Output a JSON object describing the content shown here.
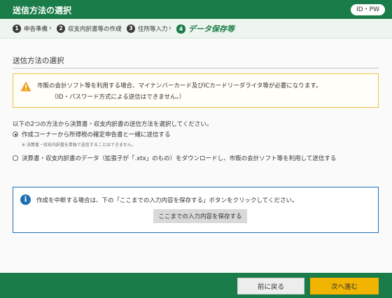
{
  "header": {
    "title": "送信方法の選択",
    "badge": "ID・PW"
  },
  "steps": [
    {
      "num": "1",
      "label": "申告準備",
      "active": false
    },
    {
      "num": "2",
      "label": "収支内訳書等の作成",
      "active": false
    },
    {
      "num": "3",
      "label": "住所等入力",
      "active": false
    },
    {
      "num": "4",
      "label": "データ保存等",
      "active": true
    }
  ],
  "step_separator": "›",
  "section": {
    "title": "送信方法の選択"
  },
  "warning": {
    "line1": "市販の会計ソフト等を利用する場合、マイナンバーカード及びICカードリーダライタ等が必要になります。",
    "line2": "（ID・パスワード方式による送信はできません。）"
  },
  "instruction": "以下の2つの方法から決算書・収支内訳書の送信方法を選択してください。",
  "options": [
    {
      "label": "作成コーナーから所得税の確定申告書と一緒に送信する",
      "checked": true,
      "note": "※ 決算書・収支内訳書を単独で送信することはできません。"
    },
    {
      "label": "決算書・収支内訳書のデータ（拡張子が「.xtx」のもの）をダウンロードし、市販の会計ソフト等を利用して送信する",
      "checked": false,
      "note": ""
    }
  ],
  "info": {
    "icon_char": "i",
    "text": "作成を中断する場合は、下の「ここまでの入力内容を保存する」ボタンをクリックしてください。",
    "save_button": "ここまでの入力内容を保存する"
  },
  "footer": {
    "back_label": "前に戻る",
    "next_label": "次へ進む"
  },
  "colors": {
    "brand_green": "#1a7c48",
    "warning_border": "#f0c040",
    "warning_icon": "#f0a020",
    "info_blue": "#1f6fb5",
    "next_button": "#f1b400"
  }
}
